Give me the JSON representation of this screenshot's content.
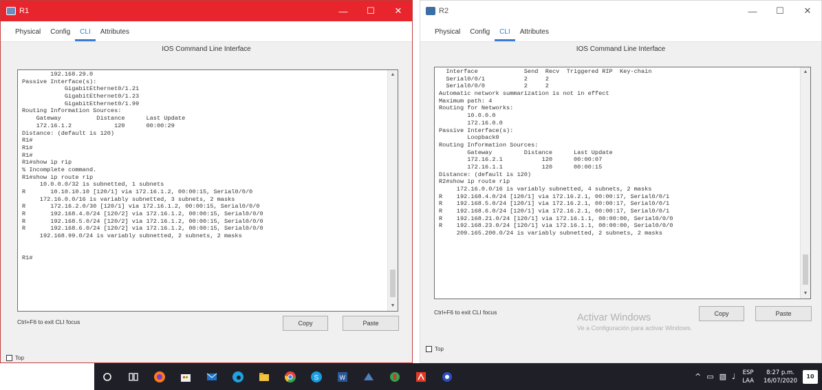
{
  "win1": {
    "title": "R1",
    "tabs": [
      "Physical",
      "Config",
      "CLI",
      "Attributes"
    ],
    "active_tab": "CLI",
    "panel_title": "IOS Command Line Interface",
    "lines": [
      "        192.168.29.0",
      "Passive Interface(s):",
      "            GigabitEthernet0/1.21",
      "            GigabitEthernet0/1.23",
      "            GigabitEthernet0/1.99",
      "Routing Information Sources:",
      "    Gateway          Distance      Last Update",
      "    172.16.1.2            120      00:00:29",
      "Distance: (default is 120)",
      "R1#",
      "R1#",
      "R1#",
      "R1#show ip rip",
      "% Incomplete command.",
      "R1#show ip route rip",
      "     10.0.0.0/32 is subnetted, 1 subnets",
      "R       10.10.10.10 [120/1] via 172.16.1.2, 00:00:15, Serial0/0/0",
      "     172.16.0.0/16 is variably subnetted, 3 subnets, 2 masks",
      "R       172.16.2.0/30 [120/1] via 172.16.1.2, 00:00:15, Serial0/0/0",
      "R       192.168.4.0/24 [120/2] via 172.16.1.2, 00:00:15, Serial0/0/0",
      "R       192.168.5.0/24 [120/2] via 172.16.1.2, 00:00:15, Serial0/0/0",
      "R       192.168.6.0/24 [120/2] via 172.16.1.2, 00:00:15, Serial0/0/0",
      "     192.168.99.0/24 is variably subnetted, 2 subnets, 2 masks",
      "",
      "",
      "R1#"
    ],
    "hint": "Ctrl+F6 to exit CLI focus",
    "copy_label": "Copy",
    "paste_label": "Paste",
    "top_label": "Top"
  },
  "win2": {
    "title": "R2",
    "tabs": [
      "Physical",
      "Config",
      "CLI",
      "Attributes"
    ],
    "active_tab": "CLI",
    "panel_title": "IOS Command Line Interface",
    "lines": [
      "  Interface             Send  Recv  Triggered RIP  Key-chain",
      "  Serial0/0/1           2     2",
      "  Serial0/0/0           2     2",
      "Automatic network summarization is not in effect",
      "Maximum path: 4",
      "Routing for Networks:",
      "        10.0.0.0",
      "        172.16.0.0",
      "Passive Interface(s):",
      "        Loopback0",
      "Routing Information Sources:",
      "        Gateway         Distance      Last Update",
      "        172.16.2.1           120      00:00:07",
      "        172.16.1.1           120      00:00:15",
      "Distance: (default is 120)",
      "R2#show ip route rip",
      "     172.16.0.0/16 is variably subnetted, 4 subnets, 2 masks",
      "R    192.168.4.0/24 [120/1] via 172.16.2.1, 00:00:17, Serial0/0/1",
      "R    192.168.5.0/24 [120/1] via 172.16.2.1, 00:00:17, Serial0/0/1",
      "R    192.168.6.0/24 [120/1] via 172.16.2.1, 00:00:17, Serial0/0/1",
      "R    192.168.21.0/24 [120/1] via 172.16.1.1, 00:00:00, Serial0/0/0",
      "R    192.168.23.0/24 [120/1] via 172.16.1.1, 00:00:00, Serial0/0/0",
      "     209.165.200.0/24 is variably subnetted, 2 subnets, 2 masks"
    ],
    "hint": "Ctrl+F6 to exit CLI focus",
    "copy_label": "Copy",
    "paste_label": "Paste",
    "top_label": "Top",
    "watermark_title": "Activar Windows",
    "watermark_sub": "Ve a Configuración para activar Windows."
  },
  "taskbar": {
    "icons": [
      "start-search-icon",
      "task-view-icon",
      "firefox-icon",
      "store-icon",
      "mail-icon",
      "edge-icon",
      "explorer-icon",
      "chrome-icon",
      "skype-icon",
      "word-icon",
      "packet-tracer-icon",
      "app-green-icon",
      "pdf-icon",
      "app-blue-icon"
    ],
    "lang_top": "ESP",
    "lang_bottom": "LAA",
    "time": "8:27 p.m.",
    "date": "16/07/2020",
    "notif_count": "10"
  },
  "colors": {
    "accent": "#3a7bd5",
    "titlebar_active": "#e8242c",
    "taskbar": "#1f1f28"
  }
}
